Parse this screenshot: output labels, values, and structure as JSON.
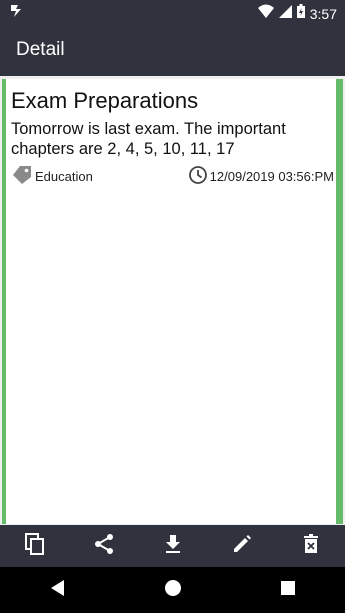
{
  "status_bar": {
    "time": "3:57",
    "icons": [
      "app-notification-icon",
      "wifi-icon",
      "signal-icon",
      "battery-icon"
    ]
  },
  "app_bar": {
    "title": "Detail"
  },
  "note": {
    "title": "Exam Preparations",
    "body": "Tomorrow is last exam. The important chapters are 2, 4, 5, 10, 11, 17",
    "category": "Education",
    "datetime": "12/09/2019 03:56:PM",
    "accent_color": "#66bb6a"
  },
  "toolbar": {
    "actions": [
      "copy-icon",
      "share-icon",
      "download-icon",
      "edit-icon",
      "delete-icon"
    ]
  },
  "nav_bar": {
    "buttons": [
      "back-icon",
      "home-icon",
      "recents-icon"
    ]
  },
  "colors": {
    "bar_background": "#30333d",
    "card_accent": "#66bb6a"
  }
}
